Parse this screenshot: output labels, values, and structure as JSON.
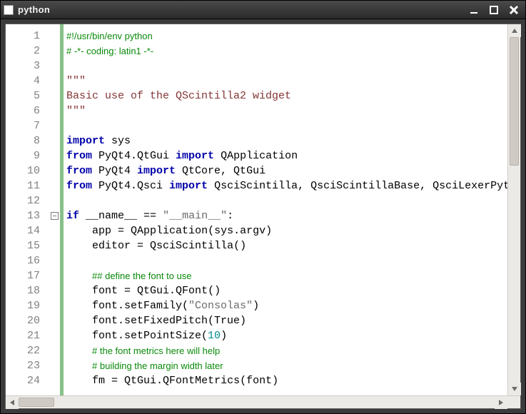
{
  "window": {
    "title": "python"
  },
  "editor": {
    "lines": [
      {
        "n": 1,
        "fold": "",
        "tokens": [
          {
            "t": "comment",
            "v": "#!/usr/bin/env python"
          }
        ]
      },
      {
        "n": 2,
        "fold": "",
        "tokens": [
          {
            "t": "comment",
            "v": "# -*- coding: latin1 -*-"
          }
        ]
      },
      {
        "n": 3,
        "fold": "",
        "tokens": []
      },
      {
        "n": 4,
        "fold": "",
        "tokens": [
          {
            "t": "docstr",
            "v": "\"\"\""
          }
        ]
      },
      {
        "n": 5,
        "fold": "",
        "tokens": [
          {
            "t": "docstr",
            "v": "Basic use of the QScintilla2 widget"
          }
        ]
      },
      {
        "n": 6,
        "fold": "",
        "tokens": [
          {
            "t": "docstr",
            "v": "\"\"\""
          }
        ]
      },
      {
        "n": 7,
        "fold": "",
        "tokens": []
      },
      {
        "n": 8,
        "fold": "",
        "tokens": [
          {
            "t": "kw",
            "v": "import"
          },
          {
            "t": "id",
            "v": " sys"
          }
        ]
      },
      {
        "n": 9,
        "fold": "",
        "tokens": [
          {
            "t": "kw",
            "v": "from"
          },
          {
            "t": "id",
            "v": " PyQt4.QtGui "
          },
          {
            "t": "kw",
            "v": "import"
          },
          {
            "t": "id",
            "v": " QApplication"
          }
        ]
      },
      {
        "n": 10,
        "fold": "",
        "tokens": [
          {
            "t": "kw",
            "v": "from"
          },
          {
            "t": "id",
            "v": " PyQt4 "
          },
          {
            "t": "kw",
            "v": "import"
          },
          {
            "t": "id",
            "v": " QtCore, QtGui"
          }
        ]
      },
      {
        "n": 11,
        "fold": "",
        "tokens": [
          {
            "t": "kw",
            "v": "from"
          },
          {
            "t": "id",
            "v": " PyQt4.Qsci "
          },
          {
            "t": "kw",
            "v": "import"
          },
          {
            "t": "id",
            "v": " QsciScintilla, QsciScintillaBase, QsciLexerPytl"
          }
        ]
      },
      {
        "n": 12,
        "fold": "",
        "tokens": []
      },
      {
        "n": 13,
        "fold": "box",
        "tokens": [
          {
            "t": "kw",
            "v": "if"
          },
          {
            "t": "id",
            "v": " __name__ "
          },
          {
            "t": "op",
            "v": "=="
          },
          {
            "t": "id",
            "v": " "
          },
          {
            "t": "str",
            "v": "\"__main__\""
          },
          {
            "t": "op",
            "v": ":"
          }
        ]
      },
      {
        "n": 14,
        "fold": "",
        "indent": "    ",
        "tokens": [
          {
            "t": "id",
            "v": "app "
          },
          {
            "t": "op",
            "v": "="
          },
          {
            "t": "id",
            "v": " QApplication(sys.argv)"
          }
        ]
      },
      {
        "n": 15,
        "fold": "",
        "indent": "    ",
        "tokens": [
          {
            "t": "id",
            "v": "editor "
          },
          {
            "t": "op",
            "v": "="
          },
          {
            "t": "id",
            "v": " QsciScintilla()"
          }
        ]
      },
      {
        "n": 16,
        "fold": "",
        "tokens": []
      },
      {
        "n": 17,
        "fold": "",
        "indent": "    ",
        "tokens": [
          {
            "t": "comment",
            "v": "## define the font to use"
          }
        ]
      },
      {
        "n": 18,
        "fold": "",
        "indent": "    ",
        "tokens": [
          {
            "t": "id",
            "v": "font "
          },
          {
            "t": "op",
            "v": "="
          },
          {
            "t": "id",
            "v": " QtGui.QFont()"
          }
        ]
      },
      {
        "n": 19,
        "fold": "",
        "indent": "    ",
        "tokens": [
          {
            "t": "id",
            "v": "font.setFamily("
          },
          {
            "t": "str",
            "v": "\"Consolas\""
          },
          {
            "t": "id",
            "v": ")"
          }
        ]
      },
      {
        "n": 20,
        "fold": "",
        "indent": "    ",
        "tokens": [
          {
            "t": "id",
            "v": "font.setFixedPitch(True)"
          }
        ]
      },
      {
        "n": 21,
        "fold": "",
        "indent": "    ",
        "tokens": [
          {
            "t": "id",
            "v": "font.setPointSize("
          },
          {
            "t": "num",
            "v": "10"
          },
          {
            "t": "id",
            "v": ")"
          }
        ]
      },
      {
        "n": 22,
        "fold": "",
        "indent": "    ",
        "tokens": [
          {
            "t": "comment",
            "v": "# the font metrics here will help"
          }
        ]
      },
      {
        "n": 23,
        "fold": "",
        "indent": "    ",
        "tokens": [
          {
            "t": "comment",
            "v": "# building the margin width later"
          }
        ]
      },
      {
        "n": 24,
        "fold": "",
        "indent": "    ",
        "tokens": [
          {
            "t": "id",
            "v": "fm "
          },
          {
            "t": "op",
            "v": "="
          },
          {
            "t": "id",
            "v": " QtGui.QFontMetrics(font)"
          }
        ]
      }
    ]
  }
}
